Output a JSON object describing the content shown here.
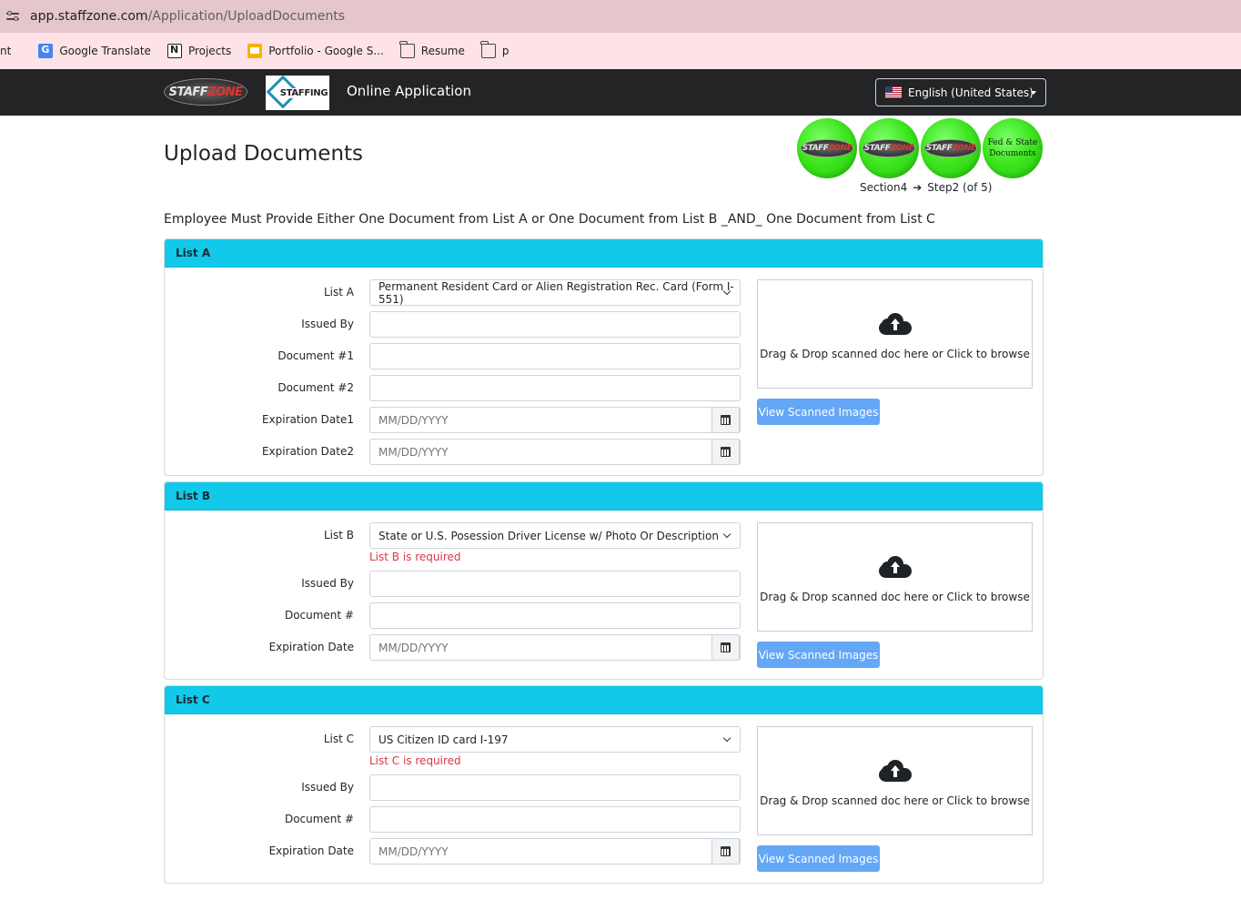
{
  "browser": {
    "url_host": "app.staffzone.com",
    "url_path": "/Application/UploadDocuments",
    "bookmarks": [
      {
        "label": "nt"
      },
      {
        "label": "Google Translate"
      },
      {
        "label": "Projects"
      },
      {
        "label": "Portfolio - Google S..."
      },
      {
        "label": "Resume"
      },
      {
        "label": "p"
      }
    ]
  },
  "navbar": {
    "logo_staff": "STAFF",
    "logo_zone": "ZONE",
    "staffing_logo_text": "STAFFING",
    "title": "Online Application",
    "language": "English (United States)"
  },
  "header": {
    "title": "Upload Documents",
    "progress_badges": [
      {
        "staff": "STAFF",
        "zone": "ZONE"
      },
      {
        "staff": "STAFF",
        "zone": "ZONE"
      },
      {
        "staff": "STAFF",
        "zone": "ZONE"
      },
      {
        "line1": "Fed & State",
        "line2": "Documents"
      }
    ],
    "section": "Section4",
    "step": "Step2 (of 5)"
  },
  "instruction": "Employee Must Provide Either One Document from List A or One Document from List B _AND_ One Document from List C",
  "list_a": {
    "heading": "List A",
    "list_label": "List A",
    "list_value": "Permanent Resident Card or Alien Registration Rec. Card (Form I-551)",
    "issued_by_label": "Issued By",
    "issued_by_value": "",
    "doc1_label": "Document #1",
    "doc1_value": "",
    "doc2_label": "Document #2",
    "doc2_value": "",
    "exp1_label": "Expiration Date1",
    "exp1_placeholder": "MM/DD/YYYY",
    "exp2_label": "Expiration Date2",
    "exp2_placeholder": "MM/DD/YYYY",
    "drop_text": "Drag & Drop scanned doc here or Click to browse",
    "view_button": "View Scanned Images"
  },
  "list_b": {
    "heading": "List B",
    "list_label": "List B",
    "list_value": "State or U.S. Posession Driver License w/ Photo Or Description",
    "error": "List B is required",
    "issued_by_label": "Issued By",
    "issued_by_value": "",
    "doc_label": "Document #",
    "doc_value": "",
    "exp_label": "Expiration Date",
    "exp_placeholder": "MM/DD/YYYY",
    "drop_text": "Drag & Drop scanned doc here or Click to browse",
    "view_button": "View Scanned Images"
  },
  "list_c": {
    "heading": "List C",
    "list_label": "List C",
    "list_value": "US Citizen ID card I-197",
    "error": "List C is required",
    "issued_by_label": "Issued By",
    "issued_by_value": "",
    "doc_label": "Document #",
    "doc_value": "",
    "exp_label": "Expiration Date",
    "exp_placeholder": "MM/DD/YYYY",
    "drop_text": "Drag & Drop scanned doc here or Click to browse",
    "view_button": "View Scanned Images"
  },
  "colors": {
    "card_header": "#12c9ea",
    "navbar": "#222426",
    "error": "#dc3545",
    "button": "#64a7f7"
  }
}
